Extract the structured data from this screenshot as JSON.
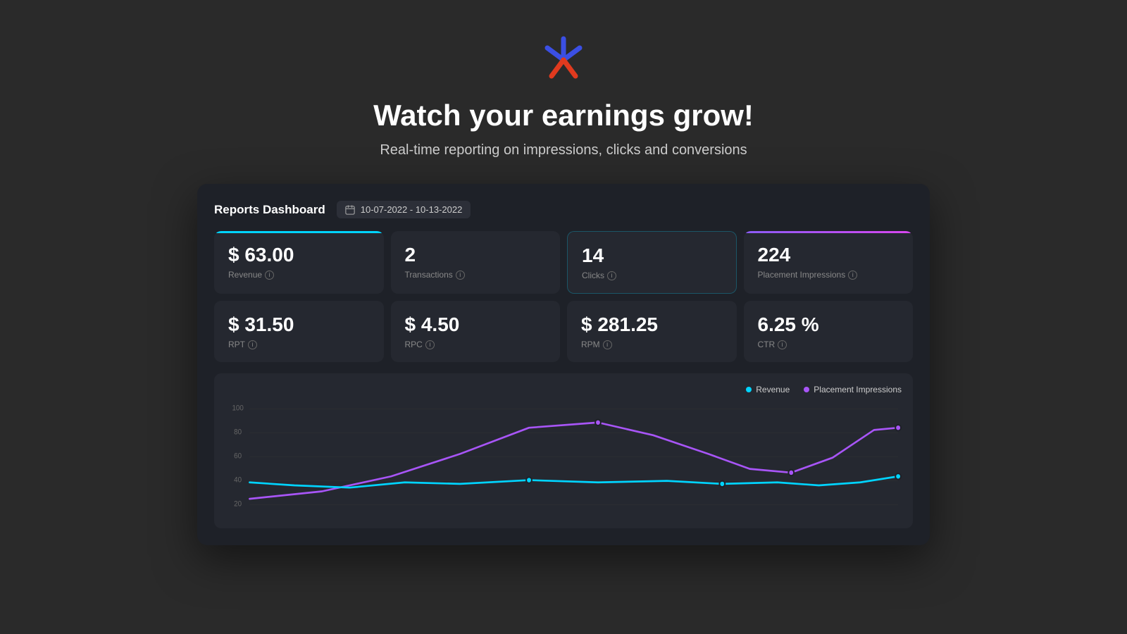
{
  "hero": {
    "title": "Watch your earnings grow!",
    "subtitle": "Real-time reporting on impressions, clicks and conversions"
  },
  "dashboard": {
    "title": "Reports Dashboard",
    "date_range": "10-07-2022 - 10-13-2022",
    "metrics_top": [
      {
        "value": "$ 63.00",
        "label": "Revenue",
        "highlight": "cyan"
      },
      {
        "value": "2",
        "label": "Transactions",
        "highlight": "none"
      },
      {
        "value": "14",
        "label": "Clicks",
        "highlight": "teal"
      },
      {
        "value": "224",
        "label": "Placement Impressions",
        "highlight": "purple"
      }
    ],
    "metrics_bottom": [
      {
        "value": "$ 31.50",
        "label": "RPT"
      },
      {
        "value": "$ 4.50",
        "label": "RPC"
      },
      {
        "value": "$ 281.25",
        "label": "RPM"
      },
      {
        "value": "6.25 %",
        "label": "CTR"
      }
    ],
    "chart": {
      "legend": {
        "revenue_label": "Revenue",
        "impressions_label": "Placement Impressions"
      },
      "y_axis": [
        "100",
        "80",
        "60",
        "40",
        "20"
      ]
    }
  }
}
